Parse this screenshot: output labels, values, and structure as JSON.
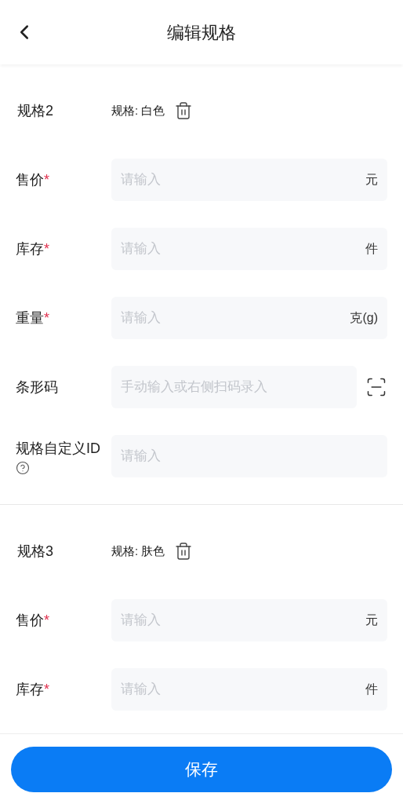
{
  "header": {
    "title": "编辑规格"
  },
  "required_mark": "*",
  "specs": [
    {
      "title": "规格2",
      "spec": "规格: 白色",
      "fields": [
        {
          "label": "售价",
          "required": true,
          "placeholder": "请输入",
          "unit": "元",
          "kind": "input"
        },
        {
          "label": "库存",
          "required": true,
          "placeholder": "请输入",
          "unit": "件",
          "kind": "input"
        },
        {
          "label": "重量",
          "required": true,
          "placeholder": "请输入",
          "unit": "克(g)",
          "kind": "input"
        },
        {
          "label": "条形码",
          "required": false,
          "placeholder": "手动输入或右侧扫码录入",
          "kind": "scan"
        },
        {
          "label": "规格自定义ID",
          "required": false,
          "placeholder": "请输入",
          "kind": "help"
        }
      ]
    },
    {
      "title": "规格3",
      "spec": "规格: 肤色",
      "fields": [
        {
          "label": "售价",
          "required": true,
          "placeholder": "请输入",
          "unit": "元",
          "kind": "input"
        },
        {
          "label": "库存",
          "required": true,
          "placeholder": "请输入",
          "unit": "件",
          "kind": "input"
        }
      ]
    }
  ],
  "save_button": "保存"
}
